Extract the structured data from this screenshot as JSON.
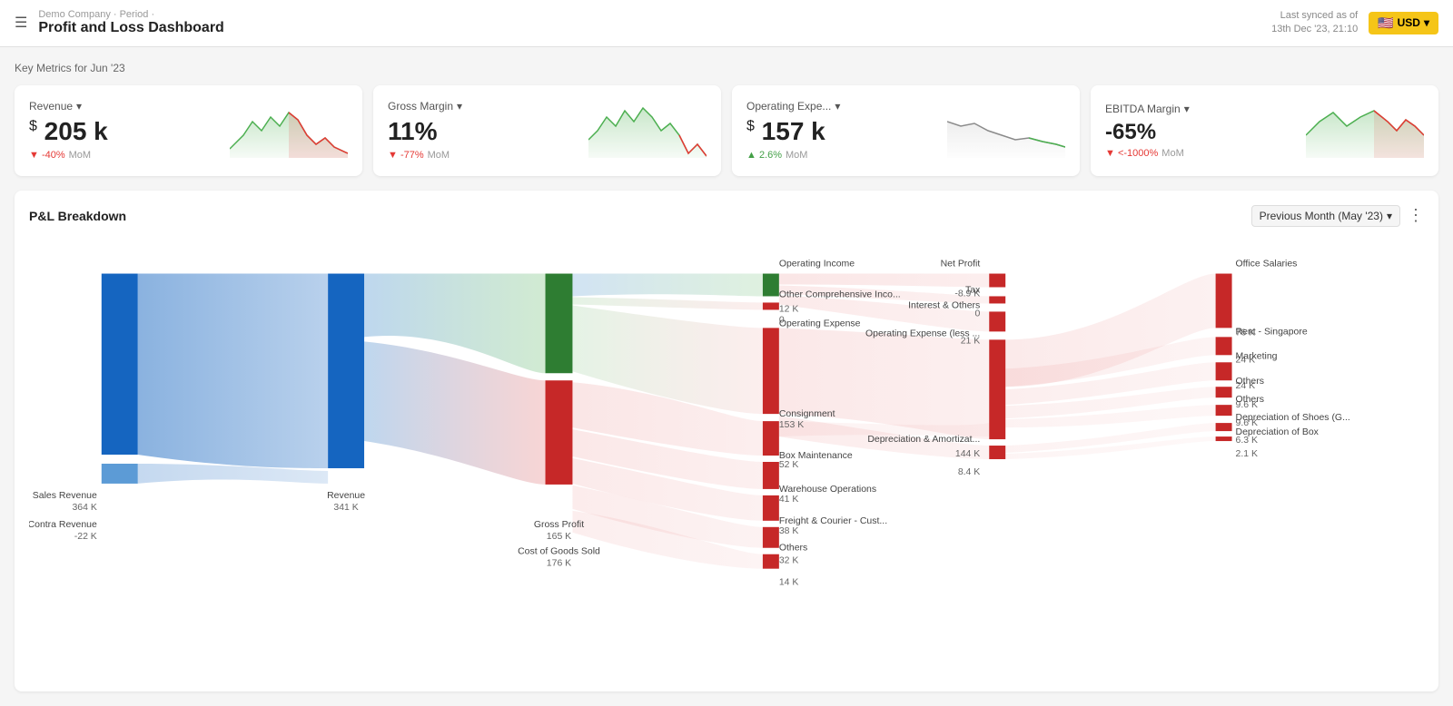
{
  "header": {
    "menu_icon": "☰",
    "breadcrumb": "Demo Company · Period ·",
    "title": "Profit and Loss Dashboard",
    "sync_label": "Last synced as of",
    "sync_date": "13th Dec '23, 21:10",
    "currency": "USD",
    "currency_dropdown": "▾"
  },
  "key_metrics": {
    "section_label": "Key Metrics for Jun '23",
    "cards": [
      {
        "id": "revenue",
        "label": "Revenue",
        "has_dropdown": true,
        "prefix": "$",
        "value": "205",
        "unit": "k",
        "change_direction": "down",
        "change_value": "-40%",
        "change_period": "MoM"
      },
      {
        "id": "gross-margin",
        "label": "Gross Margin",
        "has_dropdown": true,
        "prefix": "",
        "value": "11%",
        "unit": "",
        "change_direction": "down",
        "change_value": "-77%",
        "change_period": "MoM"
      },
      {
        "id": "operating-expense",
        "label": "Operating Expe...",
        "has_dropdown": true,
        "prefix": "$",
        "value": "157",
        "unit": "k",
        "change_direction": "up",
        "change_value": "2.6%",
        "change_period": "MoM"
      },
      {
        "id": "ebitda-margin",
        "label": "EBITDA Margin",
        "has_dropdown": true,
        "prefix": "",
        "value": "-65%",
        "unit": "",
        "change_direction": "down",
        "change_value": "<-1000%",
        "change_period": "MoM"
      }
    ]
  },
  "breakdown": {
    "title": "P&L Breakdown",
    "period_label": "Previous Month (May '23)",
    "nodes": {
      "sales_revenue": {
        "label": "Sales Revenue",
        "value": "364 K"
      },
      "contra_revenue": {
        "label": "Contra Revenue",
        "value": "-22 K"
      },
      "revenue": {
        "label": "Revenue",
        "value": "341 K"
      },
      "gross_profit": {
        "label": "Gross Profit",
        "value": "165 K"
      },
      "cogs": {
        "label": "Cost of Goods Sold",
        "value": "176 K"
      },
      "operating_income": {
        "label": "Operating Income",
        "value": "12 K"
      },
      "other_comprehensive": {
        "label": "Other Comprehensive Inco...",
        "value": "0"
      },
      "operating_expense": {
        "label": "Operating Expense",
        "value": "153 K"
      },
      "consignment": {
        "label": "Consignment",
        "value": "52 K"
      },
      "box_maintenance": {
        "label": "Box Maintenance",
        "value": "41 K"
      },
      "warehouse_operations": {
        "label": "Warehouse Operations",
        "value": "38 K"
      },
      "freight_courier": {
        "label": "Freight & Courier - Cust...",
        "value": "32 K"
      },
      "others_14k": {
        "label": "Others",
        "value": "14 K"
      },
      "net_profit": {
        "label": "Net Profit",
        "value": "-8.9 K"
      },
      "tax": {
        "label": "Tax",
        "value": "0"
      },
      "interest_others": {
        "label": "Interest & Others",
        "value": "21 K"
      },
      "op_expense_less": {
        "label": "Operating Expense (less ...",
        "value": "144 K"
      },
      "depreciation": {
        "label": "Depreciation & Amortizat...",
        "value": "8.4 K"
      },
      "office_salaries": {
        "label": "Office Salaries",
        "value": "76 K"
      },
      "rent_singapore": {
        "label": "Rent - Singapore",
        "value": "24 K"
      },
      "marketing": {
        "label": "Marketing",
        "value": "24 K"
      },
      "others_9_6k_1": {
        "label": "Others",
        "value": "9.6 K"
      },
      "others_9_6k_2": {
        "label": "Others",
        "value": "9.6 K"
      },
      "depreciation_shoes": {
        "label": "Depreciation of Shoes (G...",
        "value": "6.3 K"
      },
      "depreciation_box": {
        "label": "Depreciation of Box",
        "value": "2.1 K"
      }
    }
  }
}
